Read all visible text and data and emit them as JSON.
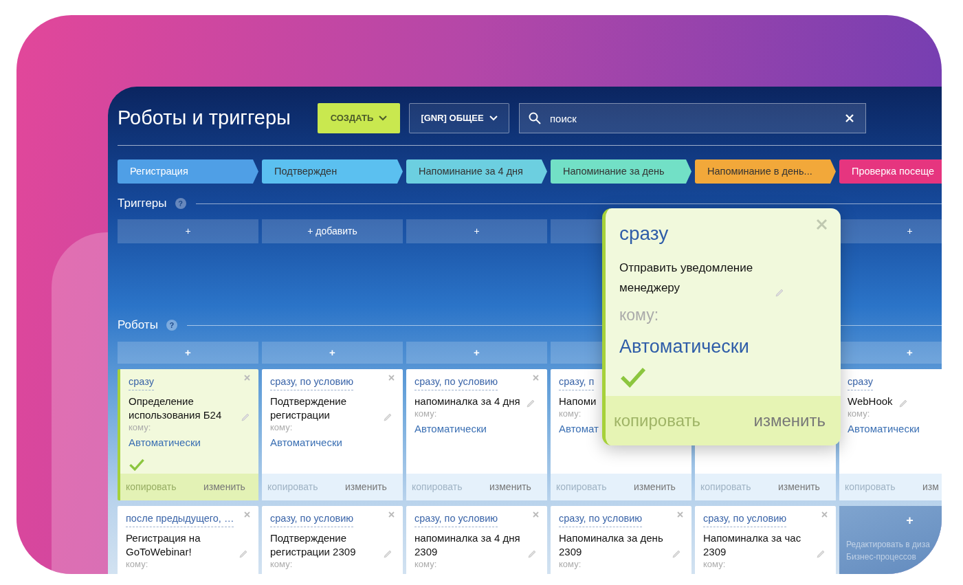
{
  "title": "Роботы и триггеры",
  "create_button": "СОЗДАТЬ",
  "scope_button": "[GNR] ОБЩЕЕ",
  "search": {
    "placeholder": "поиск"
  },
  "stages": [
    {
      "label": "Регистрация",
      "color": "#4f9fe6"
    },
    {
      "label": "Подтвержден",
      "color": "#5bc0f0"
    },
    {
      "label": "Напоминание за 4 дня",
      "color": "#6ccfe0"
    },
    {
      "label": "Напоминание за день",
      "color": "#72e0c6"
    },
    {
      "label": "Напоминание в день...",
      "color": "#f2a83a"
    },
    {
      "label": "Проверка посеще",
      "color": "#e6357f"
    }
  ],
  "triggers": {
    "title": "Триггеры",
    "help": "?",
    "cells": [
      "+",
      "+ добавить",
      "+",
      null,
      null,
      "+"
    ]
  },
  "robots": {
    "title": "Роботы",
    "help": "?",
    "add_cells": [
      "+",
      "+",
      "+",
      null,
      null,
      "+"
    ],
    "rows": [
      [
        {
          "kind": "robot",
          "condition": "сразу",
          "name": "Определение использования Б24",
          "pencil": true,
          "closable": true,
          "to_label": "кому:",
          "to_value": "Автоматически",
          "selected": true,
          "done": true,
          "copy": "копировать",
          "edit": "изменить"
        },
        {
          "kind": "robot",
          "condition": "сразу, по условию",
          "name": "Подтверждение регистрации",
          "pencil": true,
          "closable": true,
          "to_label": "кому:",
          "to_value": "Автоматически",
          "selected": false,
          "done": false,
          "copy": "копировать",
          "edit": "изменить"
        },
        {
          "kind": "robot",
          "condition": "сразу, по условию",
          "name": "напоминалка за 4 дня",
          "pencil": true,
          "closable": true,
          "to_label": "кому:",
          "to_value": "Автоматически",
          "selected": false,
          "done": false,
          "copy": "копировать",
          "edit": "изменить"
        },
        {
          "kind": "robot",
          "condition": "сразу, п",
          "name": "Напоми",
          "to_label": "кому:",
          "to_value": "Автомат",
          "selected": false,
          "done": false,
          "copy": "копировать",
          "edit": "изменить"
        },
        {
          "kind": "robot",
          "selected": false,
          "copy": "копировать",
          "edit": "изменить"
        },
        {
          "kind": "robot",
          "condition": "сразу",
          "name": "WebHook",
          "pencil": true,
          "closable": false,
          "to_label": "кому:",
          "to_value": "Автоматически",
          "selected": false,
          "done": false,
          "copy": "копировать",
          "edit": "изм"
        }
      ],
      [
        {
          "kind": "robot",
          "condition": "после предыдущего, …",
          "name": "Регистрация на GoToWebinar!",
          "pencil": true,
          "closable": true,
          "to_label": "кому:",
          "selected": false
        },
        {
          "kind": "robot",
          "condition": "сразу, по условию",
          "name": "Подтверждение регистрации 2309",
          "pencil": true,
          "closable": true,
          "to_label": "кому:",
          "selected": false
        },
        {
          "kind": "robot",
          "condition": "сразу, по условию",
          "name": "напоминалка за 4 дня 2309",
          "pencil": true,
          "closable": true,
          "to_label": "кому:",
          "selected": false
        },
        {
          "kind": "robot",
          "condition": "сразу, по условию",
          "name": "Напоминалка за день 2309",
          "pencil": true,
          "closable": true,
          "to_label": "кому:",
          "selected": false
        },
        {
          "kind": "robot",
          "condition": "сразу, по условию",
          "name": "Напоминалка за час 2309",
          "pencil": true,
          "closable": true,
          "to_label": "кому:",
          "selected": false
        },
        {
          "kind": "designer",
          "plus": "+",
          "text": "Редактировать в диза",
          "text2": "Бизнес-процессов"
        }
      ]
    ]
  },
  "popup": {
    "condition": "сразу",
    "name": "Отправить уведомление менеджеру",
    "to_label": "кому:",
    "to_value": "Автоматически",
    "done": true,
    "copy": "копировать",
    "edit": "изменить"
  }
}
